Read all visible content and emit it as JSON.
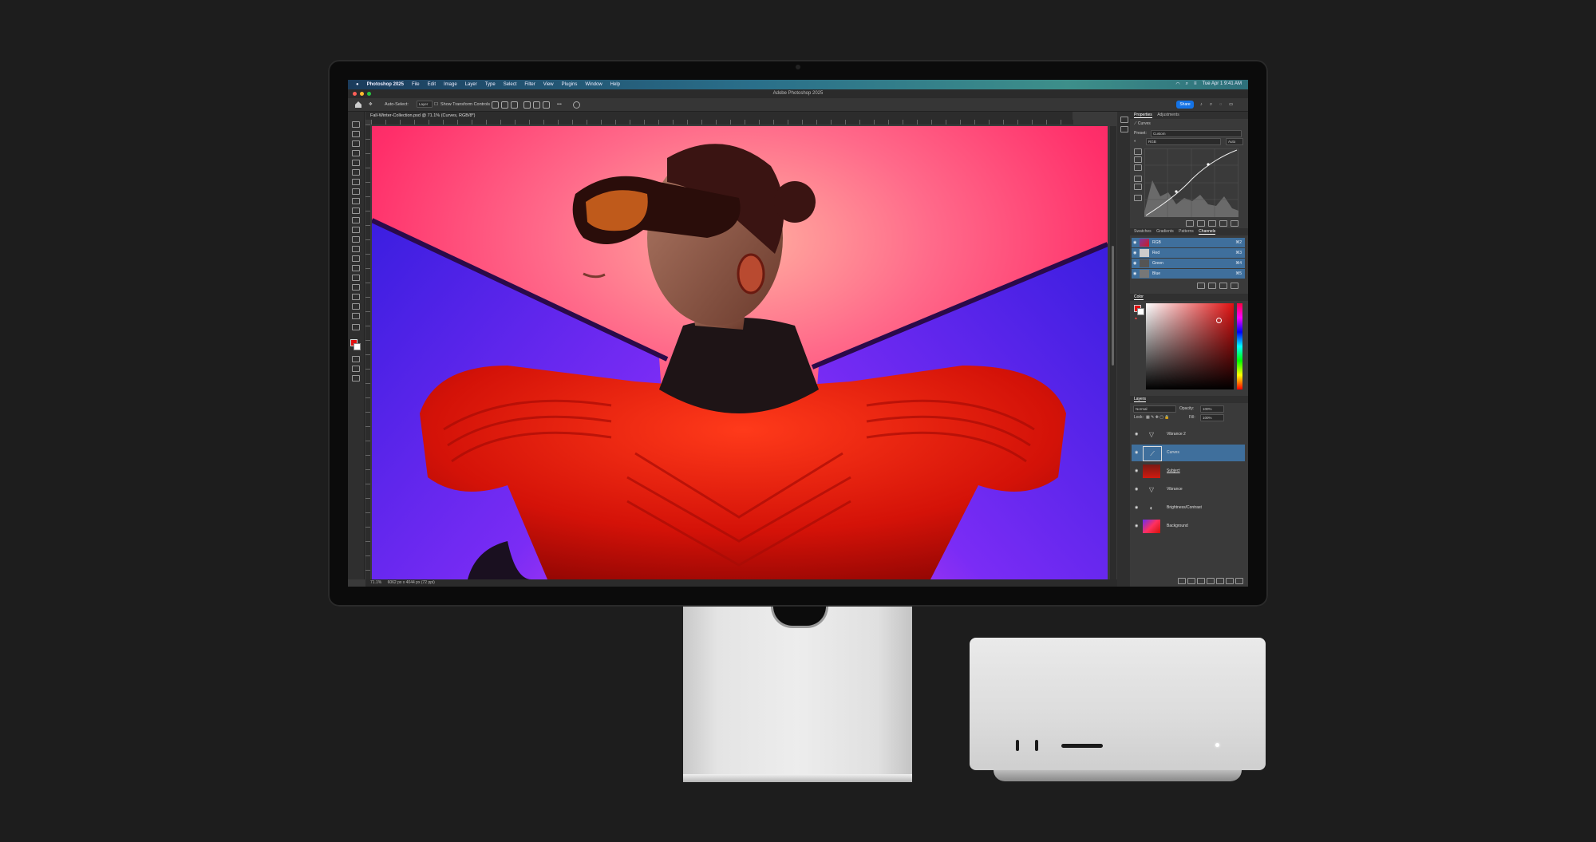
{
  "menubar": {
    "app": "Photoshop 2025",
    "items": [
      "File",
      "Edit",
      "Image",
      "Layer",
      "Type",
      "Select",
      "Filter",
      "View",
      "Plugins",
      "Window",
      "Help"
    ],
    "clock": "Tue Apr 1 9:41 AM"
  },
  "window": {
    "title": "Adobe Photoshop 2025"
  },
  "options": {
    "auto_select": "Auto-Select:",
    "layer_value": "Layer",
    "transform": "Show Transform Controls",
    "share": "Share"
  },
  "document": {
    "tab": "Fall-Winter-Collection.psd @ 71.1% (Curves, RGB/8*)"
  },
  "status": {
    "zoom": "71.1%",
    "dimensions": "6062 px x 4044 px (72 ppi)"
  },
  "properties": {
    "tabs": [
      "Properties",
      "Adjustments"
    ],
    "section": "Curves",
    "preset_label": "Preset:",
    "preset_value": "Custom",
    "channel_value": "RGB",
    "auto_label": "Auto"
  },
  "channels": {
    "tabs": [
      "Swatches",
      "Gradients",
      "Patterns",
      "Channels"
    ],
    "rows": [
      {
        "name": "RGB",
        "shortcut": "⌘2"
      },
      {
        "name": "Red",
        "shortcut": "⌘3"
      },
      {
        "name": "Green",
        "shortcut": "⌘4"
      },
      {
        "name": "Blue",
        "shortcut": "⌘5"
      }
    ]
  },
  "color": {
    "tab": "Color"
  },
  "layers": {
    "tab": "Layers",
    "blend_mode": "Normal",
    "opacity_label": "Opacity:",
    "opacity_value": "100%",
    "lock_label": "Lock:",
    "fill_label": "Fill:",
    "fill_value": "100%",
    "items": [
      {
        "name": "Vibrance 2"
      },
      {
        "name": "Curves"
      },
      {
        "name": "Subject"
      },
      {
        "name": "Vibrance"
      },
      {
        "name": "Brightness/Contrast"
      },
      {
        "name": "Background"
      }
    ]
  },
  "colors": {
    "accent": "#1473e6",
    "selection": "#3f6f9c",
    "foreground": "#e01010"
  }
}
